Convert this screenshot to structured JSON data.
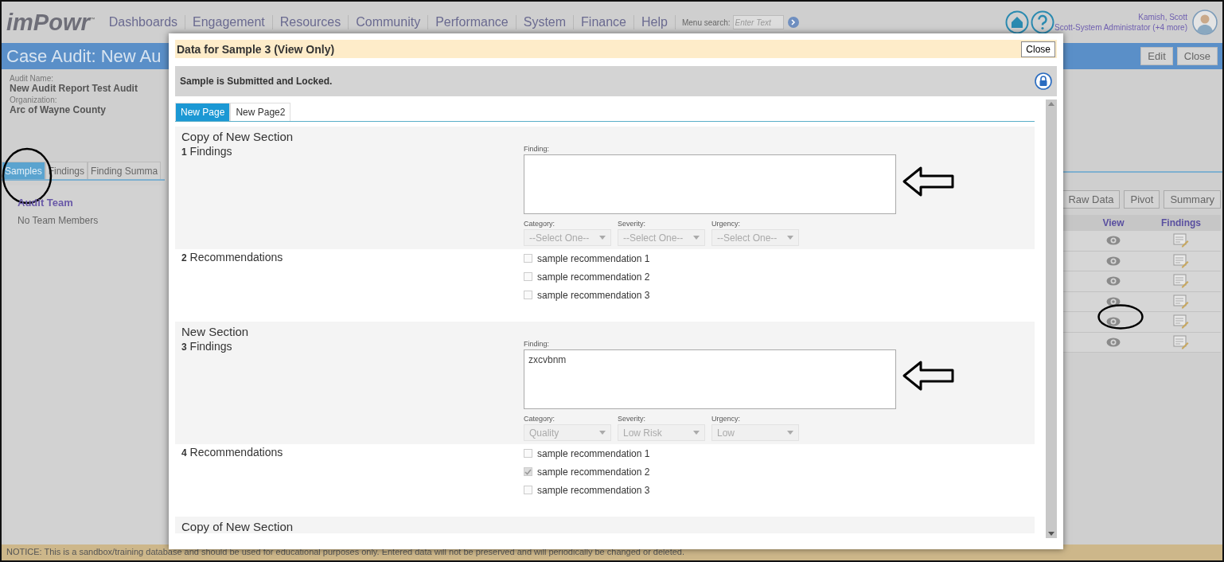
{
  "app": {
    "logo": "imPowr",
    "logo_mark": "™"
  },
  "nav": [
    "Dashboards",
    "Engagement",
    "Resources",
    "Community",
    "Performance",
    "System",
    "Finance",
    "Help"
  ],
  "menu_search": {
    "label": "Menu search:",
    "placeholder": "Enter Text"
  },
  "user": {
    "name": "Kamish, Scott",
    "role": "Scott-System Administrator (+4 more)"
  },
  "page": {
    "title": "Case Audit: New Au",
    "actions": [
      "Edit",
      "Close"
    ]
  },
  "audit_info": [
    {
      "label": "Audit Name:",
      "value": "New Audit Report Test Audit"
    },
    {
      "label": "Organization:",
      "value": "Arc of Wayne County"
    }
  ],
  "tabs": [
    {
      "label": "Samples",
      "selected": true
    },
    {
      "label": "Findings",
      "selected": false
    },
    {
      "label": "Finding Summa",
      "selected": false
    }
  ],
  "audit_team": {
    "title": "Audit Team",
    "empty_text": "No Team Members"
  },
  "sample_toolbar": [
    "Raw Data",
    "Pivot",
    "Summary"
  ],
  "samples_table": {
    "columns": [
      "View",
      "Findings"
    ],
    "rows": [
      {
        "view": true,
        "findings": true
      },
      {
        "view": true,
        "findings": true
      },
      {
        "view": true,
        "findings": true
      },
      {
        "view": true,
        "findings": true
      },
      {
        "view": true,
        "findings": true
      },
      {
        "view": true,
        "findings": true
      }
    ]
  },
  "notice": "NOTICE: This is a sandbox/training database and should be used for educational purposes only. Entered data will not be preserved and will periodically be changed or deleted.",
  "dialog": {
    "title": "Data for Sample 3 (View Only)",
    "close": "Close",
    "status": "Sample is Submitted and Locked.",
    "tabs": [
      {
        "label": "New Page",
        "selected": true
      },
      {
        "label": "New Page2",
        "selected": false
      }
    ],
    "sections": [
      {
        "title": "Copy of New Section",
        "questions": [
          {
            "kind": "finding",
            "number": "1",
            "label": "Findings",
            "field_label": "Finding:",
            "selects": [
              {
                "label": "Category:",
                "placeholder": "--Select One--",
                "disabled": true
              },
              {
                "label": "Severity:",
                "placeholder": "--Select One--",
                "disabled": true
              },
              {
                "label": "Urgency:",
                "placeholder": "--Select One--",
                "disabled": true
              }
            ]
          },
          {
            "kind": "recommendations",
            "number": "2",
            "label": "Recommendations",
            "options": [
              {
                "label": "sample recommendation 1",
                "checked": false
              },
              {
                "label": "sample recommendation 2",
                "checked": false
              },
              {
                "label": "sample recommendation 3",
                "checked": false
              }
            ]
          }
        ]
      },
      {
        "title": "New Section",
        "questions": [
          {
            "kind": "finding",
            "number": "3",
            "label": "Findings",
            "field_label": "Finding:",
            "value": "zxcvbnm",
            "selects": [
              {
                "label": "Category:",
                "value": "Quality",
                "disabled": true
              },
              {
                "label": "Severity:",
                "value": "Low Risk",
                "disabled": true
              },
              {
                "label": "Urgency:",
                "value": "Low",
                "disabled": true
              }
            ]
          },
          {
            "kind": "recommendations",
            "number": "4",
            "label": "Recommendations",
            "options": [
              {
                "label": "sample recommendation 1",
                "checked": false
              },
              {
                "label": "sample recommendation 2",
                "checked": true
              },
              {
                "label": "sample recommendation 3",
                "checked": false
              }
            ]
          }
        ]
      },
      {
        "title": "Copy of New Section"
      }
    ]
  }
}
